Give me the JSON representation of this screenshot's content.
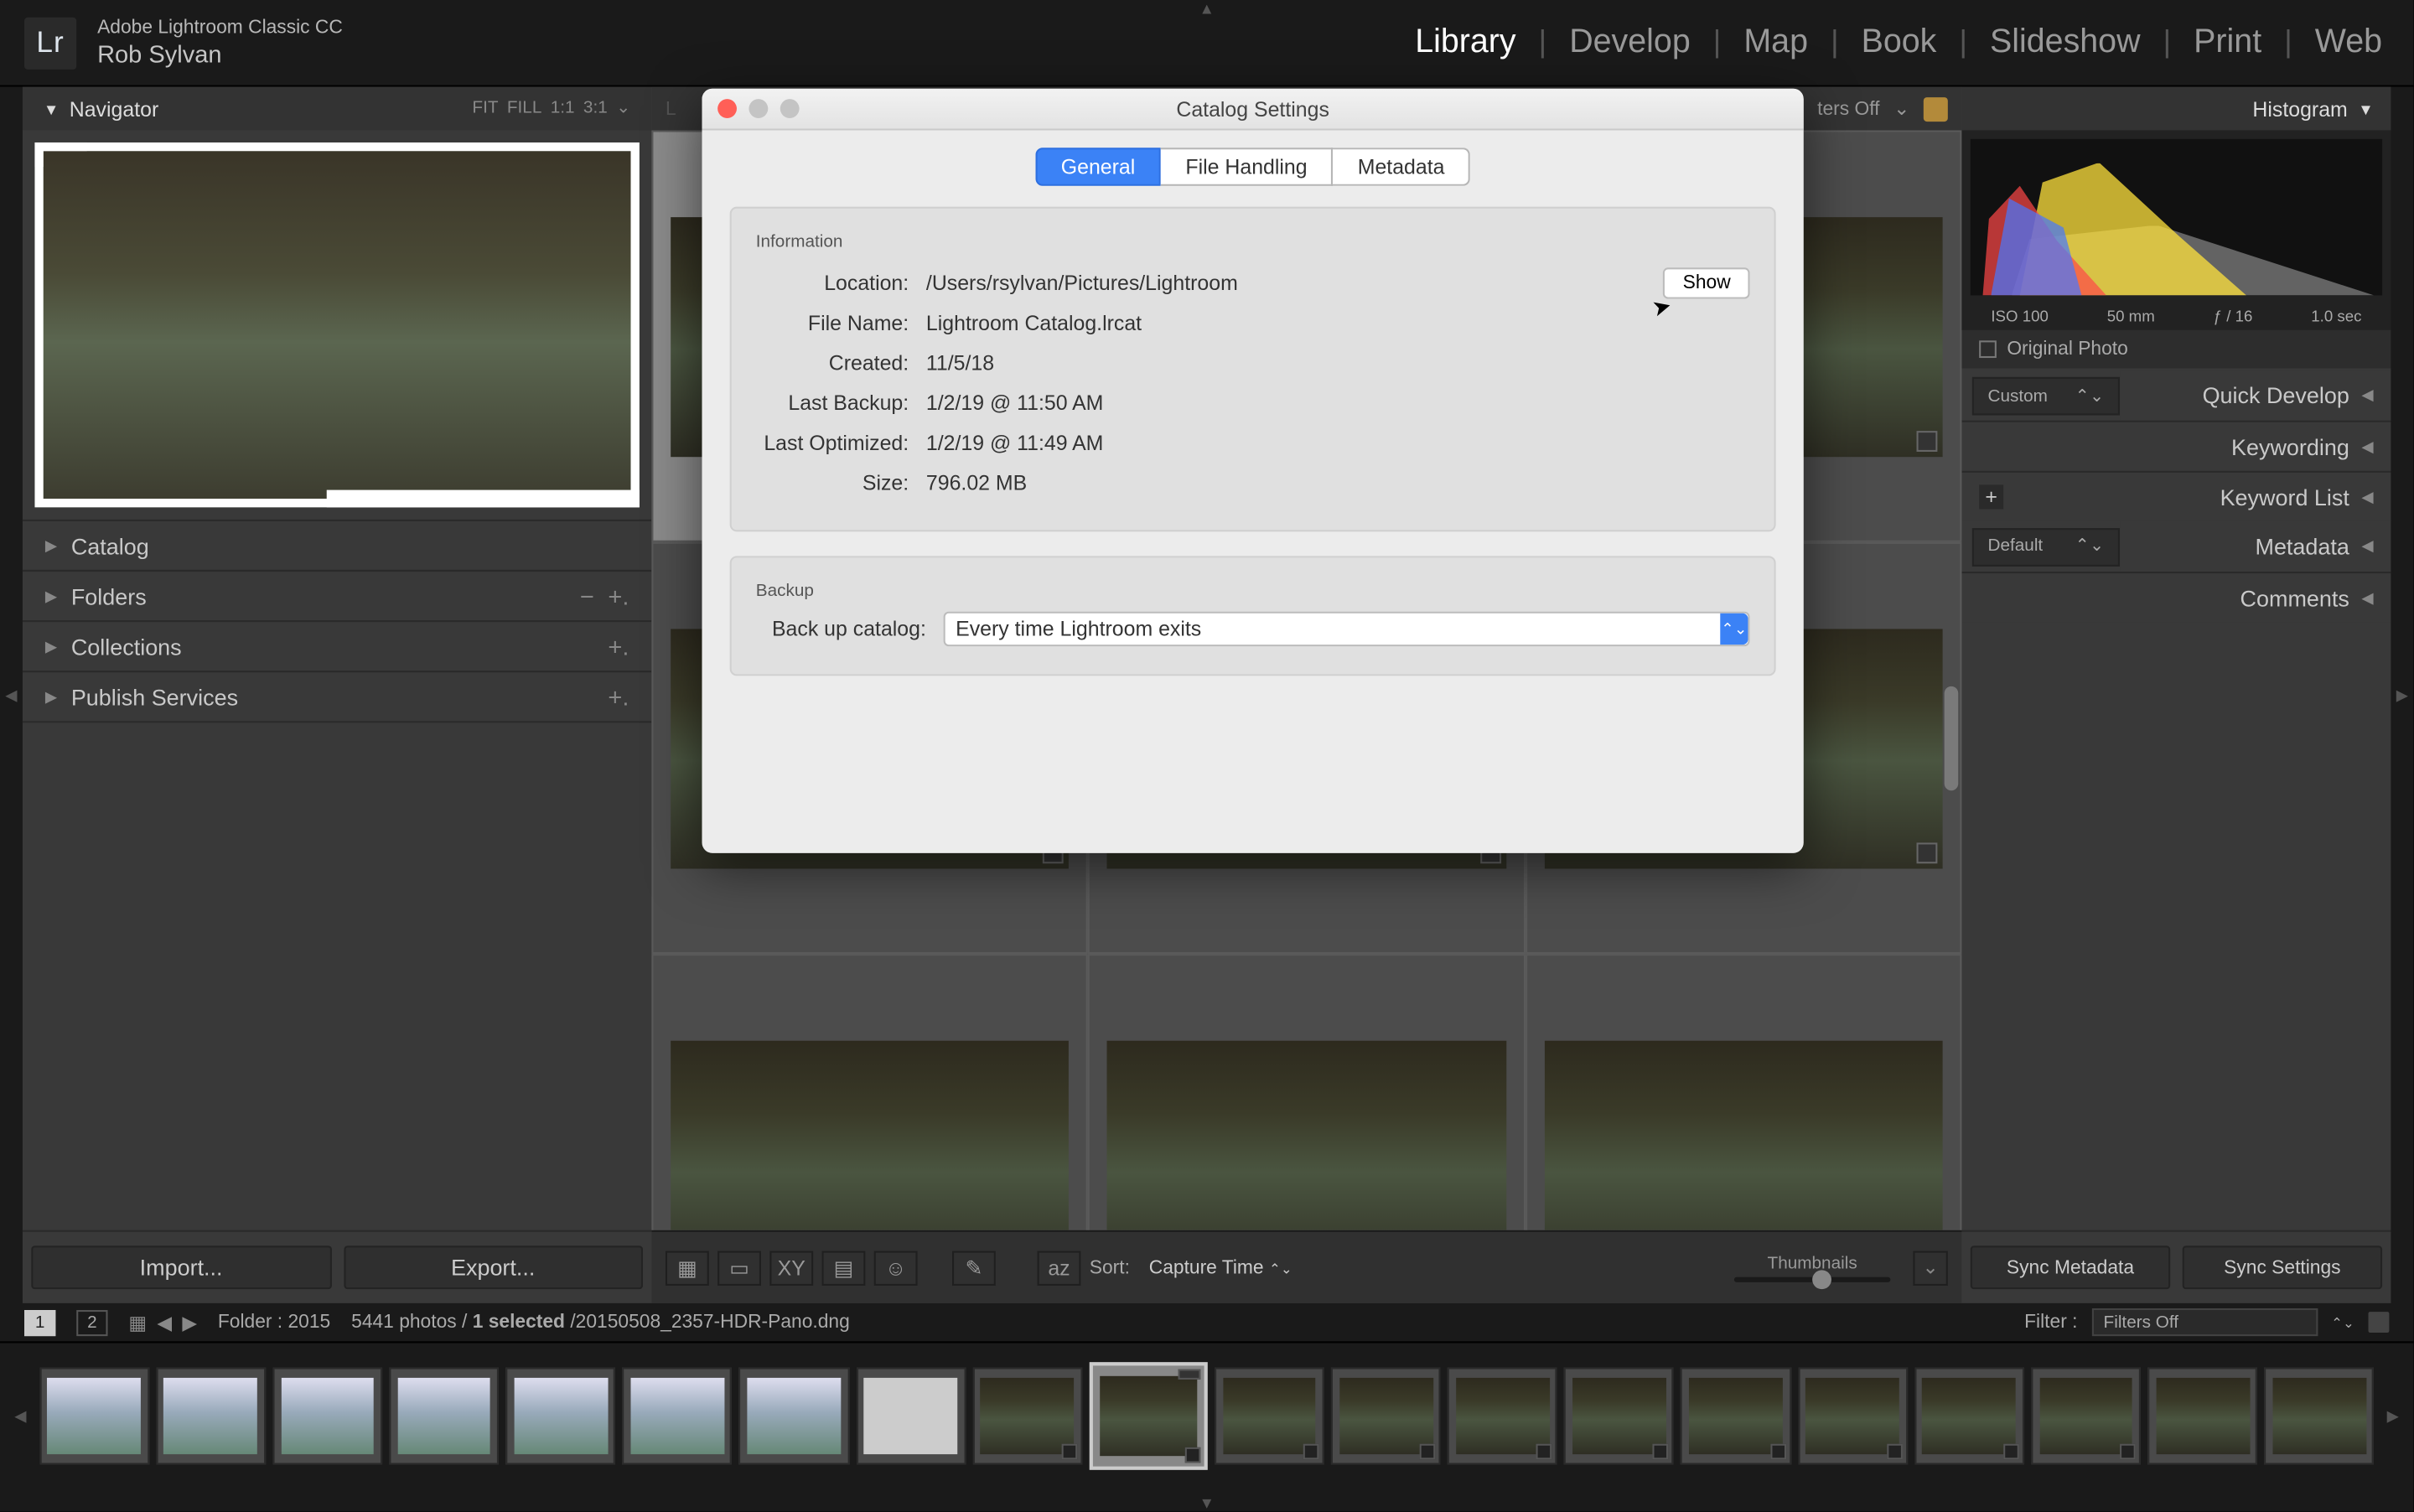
{
  "header": {
    "app_name": "Adobe Lightroom Classic CC",
    "identity": "Rob Sylvan",
    "logo_text": "Lr"
  },
  "modules": {
    "library": "Library",
    "develop": "Develop",
    "map": "Map",
    "book": "Book",
    "slideshow": "Slideshow",
    "print": "Print",
    "web": "Web",
    "active": "library"
  },
  "left": {
    "navigator": "Navigator",
    "nav_presets": [
      "FIT",
      "FILL",
      "1:1",
      "3:1"
    ],
    "sections": {
      "catalog": "Catalog",
      "folders": "Folders",
      "collections": "Collections",
      "publish": "Publish Services"
    },
    "import_btn": "Import...",
    "export_btn": "Export..."
  },
  "filterbar": {
    "filters_off": "ters Off"
  },
  "toolbar": {
    "sort_label": "Sort:",
    "sort_value": "Capture Time",
    "thumbnails_label": "Thumbnails"
  },
  "right": {
    "histogram": "Histogram",
    "hist_info": {
      "iso": "ISO 100",
      "focal": "50 mm",
      "aperture": "ƒ / 16",
      "shutter": "1.0 sec"
    },
    "original_photo": "Original Photo",
    "custom_dd": "Custom",
    "quick_develop": "Quick Develop",
    "keywording": "Keywording",
    "keyword_list": "Keyword List",
    "default_dd": "Default",
    "metadata": "Metadata",
    "comments": "Comments",
    "sync_metadata": "Sync Metadata",
    "sync_settings": "Sync Settings"
  },
  "status": {
    "page1": "1",
    "page2": "2",
    "folder_label": "Folder :",
    "folder_name": "2015",
    "count": "5441 photos",
    "selected": "1 selected",
    "filename": "20150508_2357-HDR-Pano.dng",
    "filter_label": "Filter :",
    "filter_value": "Filters Off"
  },
  "modal": {
    "title": "Catalog Settings",
    "tabs": {
      "general": "General",
      "file_handling": "File Handling",
      "metadata": "Metadata"
    },
    "section_info": "Information",
    "section_backup": "Backup",
    "show_btn": "Show",
    "rows": {
      "location_k": "Location:",
      "location_v": "/Users/rsylvan/Pictures/Lightroom",
      "filename_k": "File Name:",
      "filename_v": "Lightroom Catalog.lrcat",
      "created_k": "Created:",
      "created_v": "11/5/18",
      "backup_k": "Last Backup:",
      "backup_v": "1/2/19 @ 11:50 AM",
      "optimized_k": "Last Optimized:",
      "optimized_v": "1/2/19 @ 11:49 AM",
      "size_k": "Size:",
      "size_v": "796.02 MB"
    },
    "backup_label": "Back up catalog:",
    "backup_value": "Every time Lightroom exits"
  }
}
